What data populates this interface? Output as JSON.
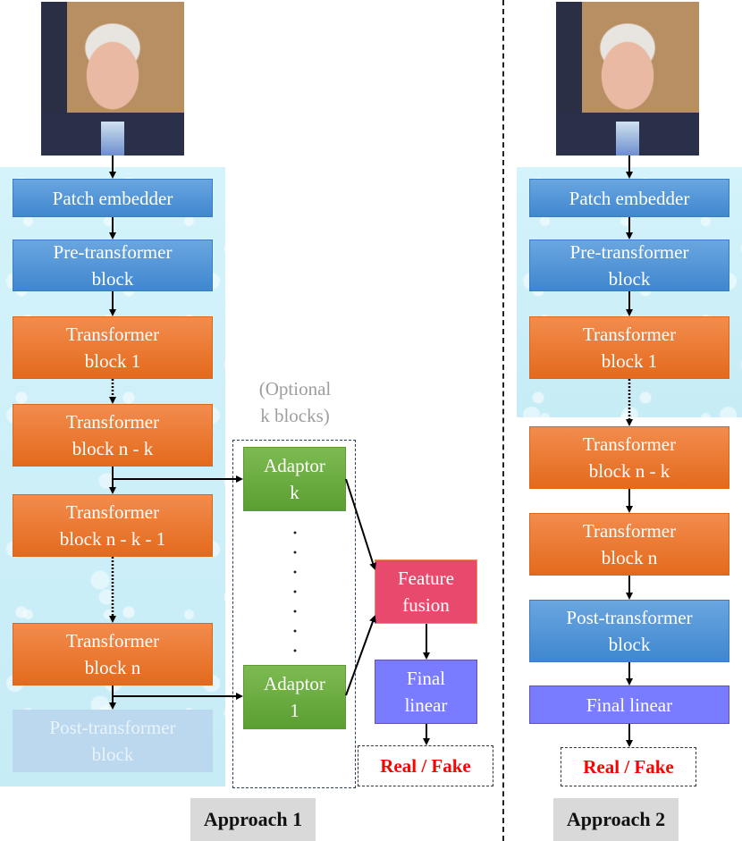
{
  "approach1": {
    "label": "Approach 1",
    "input_image": "face-photo",
    "blocks": {
      "patch_embedder": "Patch embedder",
      "pre_transformer": [
        "Pre-transformer",
        "block"
      ],
      "transformer_1": [
        "Transformer",
        "block 1"
      ],
      "transformer_nk": [
        "Transformer",
        "block n - k"
      ],
      "transformer_nk1": [
        "Transformer",
        "block n - k - 1"
      ],
      "transformer_n": [
        "Transformer",
        "block n"
      ],
      "post_transformer": [
        "Post-transformer",
        "block"
      ]
    },
    "optional_note": [
      "(Optional",
      "k blocks)"
    ],
    "adaptor_k": [
      "Adaptor",
      "k"
    ],
    "adaptor_1": [
      "Adaptor",
      "1"
    ],
    "feature_fusion": [
      "Feature",
      "fusion"
    ],
    "final_linear": [
      "Final",
      "linear"
    ],
    "output": "Real / Fake"
  },
  "approach2": {
    "label": "Approach 2",
    "input_image": "face-photo",
    "blocks": {
      "patch_embedder": "Patch embedder",
      "pre_transformer": [
        "Pre-transformer",
        "block"
      ],
      "transformer_1": [
        "Transformer",
        "block 1"
      ],
      "transformer_nk": [
        "Transformer",
        "block n - k"
      ],
      "transformer_n": [
        "Transformer",
        "block n"
      ],
      "post_transformer": [
        "Post-transformer",
        "block"
      ],
      "final_linear": "Final linear"
    },
    "output": "Real / Fake"
  },
  "colors": {
    "frozen_panel": "#cdeff8",
    "embed_blue": "#4f93d6",
    "transformer_orange": "#ec7a30",
    "adaptor_green": "#6aab40",
    "fusion_pink": "#e84a6e",
    "linear_purple": "#7a7cff",
    "output_red": "#ff0000",
    "label_gray": "#d9d9d9"
  }
}
